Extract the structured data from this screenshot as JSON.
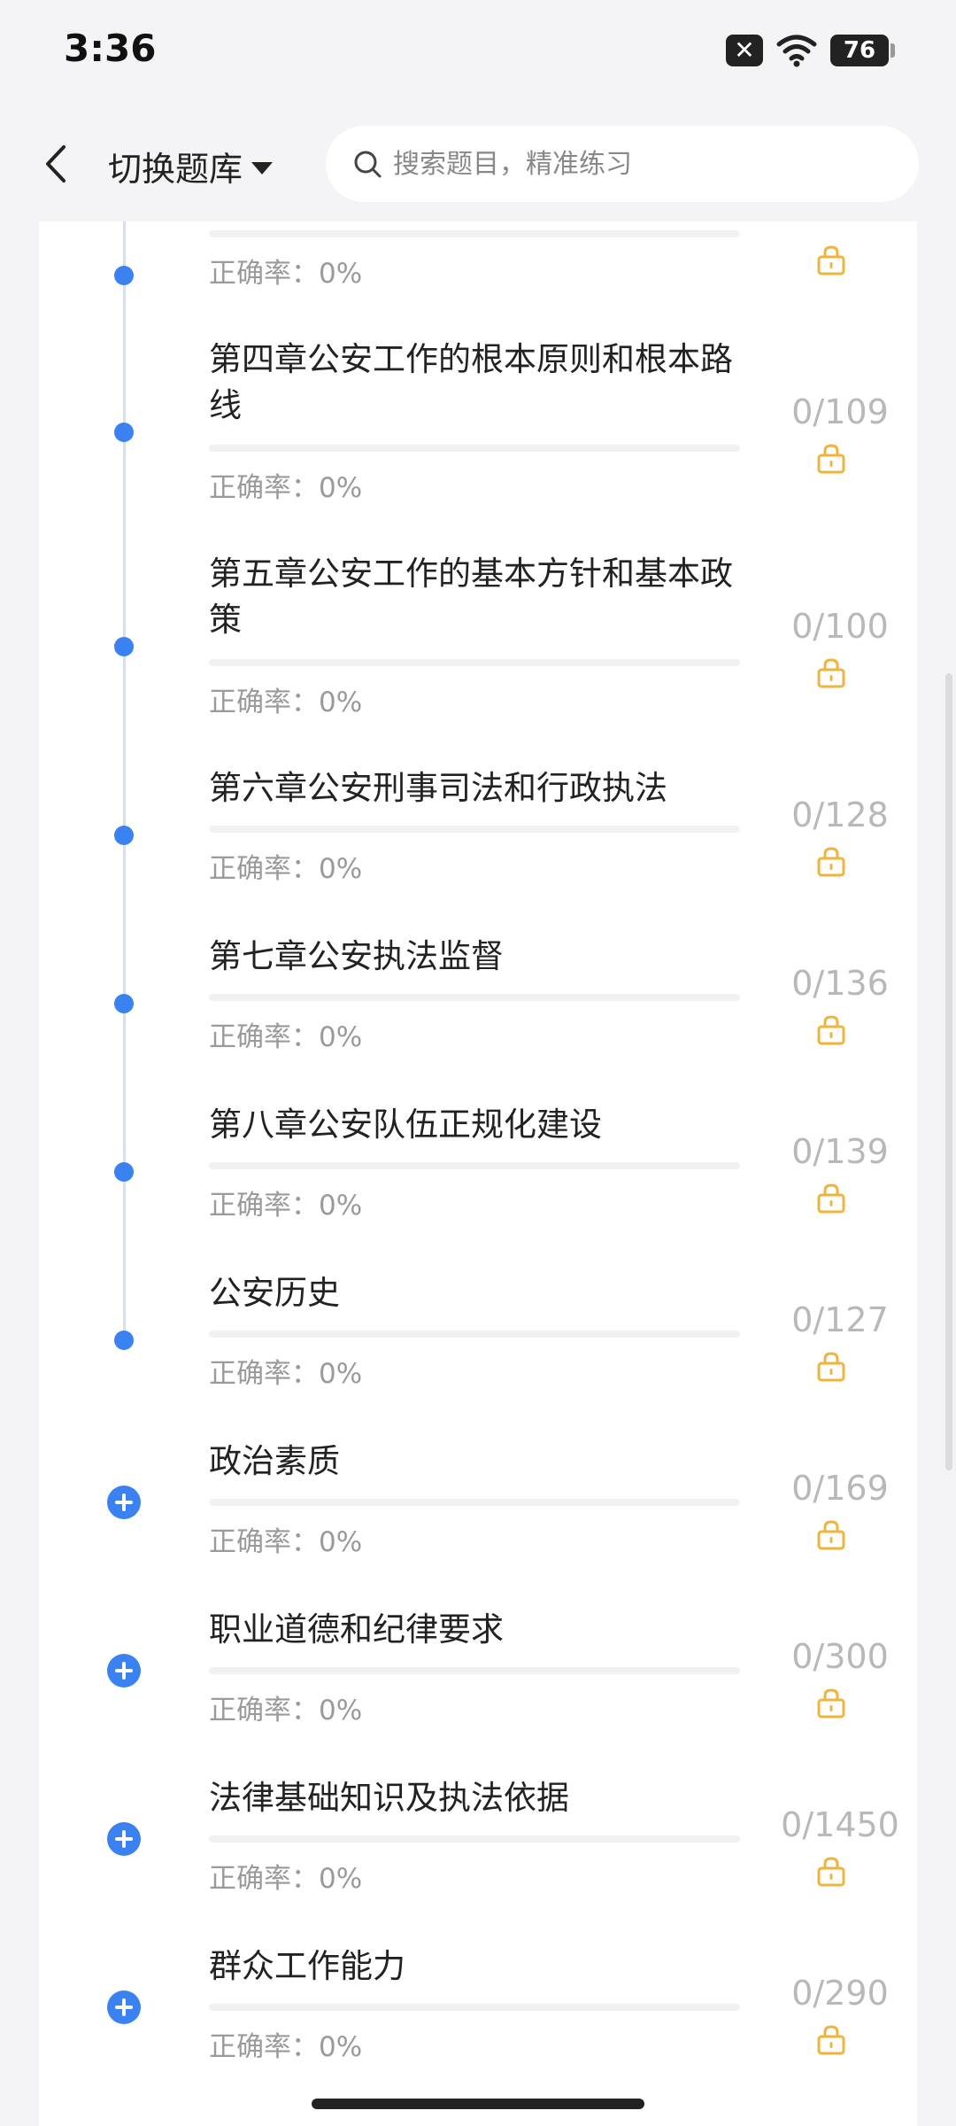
{
  "status": {
    "time": "3:36",
    "battery": "76",
    "sim_glyph": "✕"
  },
  "header": {
    "bank_switch_label": "切换题库",
    "search_placeholder": "搜索题目，精准练习"
  },
  "colors": {
    "accent_blue": "#3a82f2",
    "lock_orange": "#f0b43c",
    "muted_gray": "#9a9a9a"
  },
  "chapters": [
    {
      "title": "",
      "count": "",
      "accuracy": "正确率：0%",
      "marker": "dot"
    },
    {
      "title": "第四章公安工作的根本原则和根本路线",
      "count": "0/109",
      "accuracy": "正确率：0%",
      "marker": "dot"
    },
    {
      "title": "第五章公安工作的基本方针和基本政策",
      "count": "0/100",
      "accuracy": "正确率：0%",
      "marker": "dot"
    },
    {
      "title": "第六章公安刑事司法和行政执法",
      "count": "0/128",
      "accuracy": "正确率：0%",
      "marker": "dot"
    },
    {
      "title": "第七章公安执法监督",
      "count": "0/136",
      "accuracy": "正确率：0%",
      "marker": "dot"
    },
    {
      "title": "第八章公安队伍正规化建设",
      "count": "0/139",
      "accuracy": "正确率：0%",
      "marker": "dot"
    },
    {
      "title": "公安历史",
      "count": "0/127",
      "accuracy": "正确率：0%",
      "marker": "dot"
    },
    {
      "title": "政治素质",
      "count": "0/169",
      "accuracy": "正确率：0%",
      "marker": "plus"
    },
    {
      "title": "职业道德和纪律要求",
      "count": "0/300",
      "accuracy": "正确率：0%",
      "marker": "plus"
    },
    {
      "title": "法律基础知识及执法依据",
      "count": "0/1450",
      "accuracy": "正确率：0%",
      "marker": "plus"
    },
    {
      "title": "群众工作能力",
      "count": "0/290",
      "accuracy": "正确率：0%",
      "marker": "plus"
    }
  ]
}
